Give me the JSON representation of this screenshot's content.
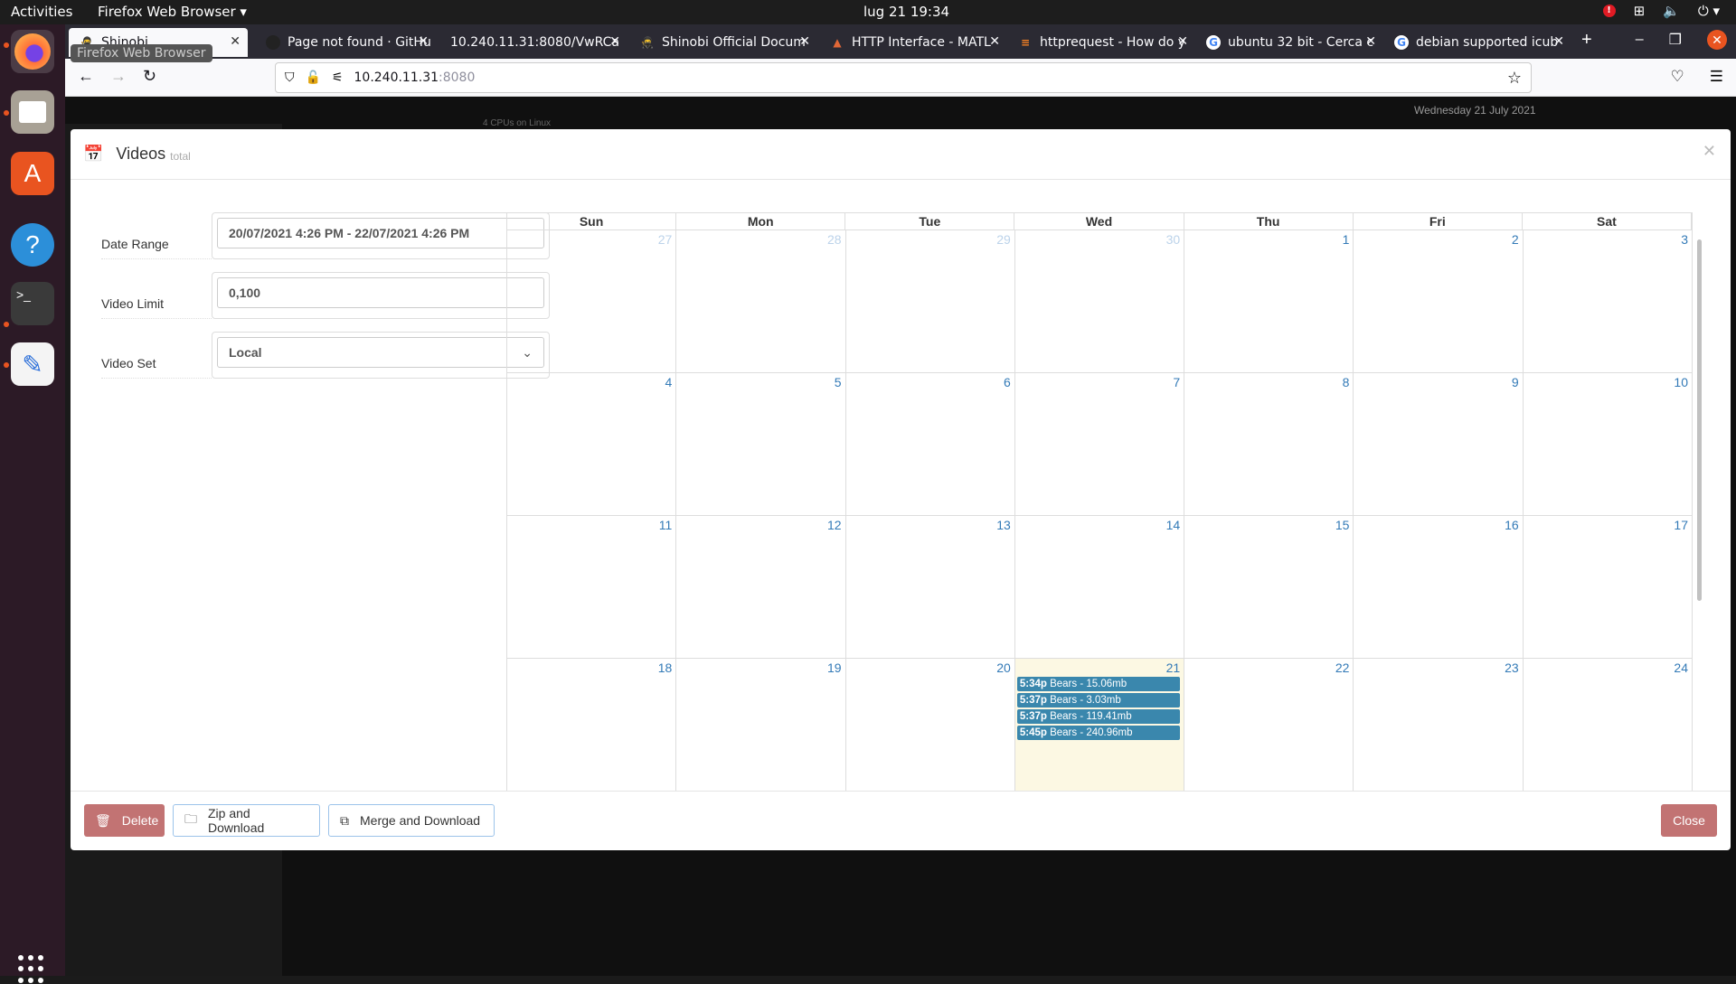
{
  "topbar": {
    "activities": "Activities",
    "app": "Firefox Web Browser ▾",
    "clock": "lug 21  19:34"
  },
  "browser": {
    "tooltip": "Firefox Web Browser",
    "tabs": [
      {
        "title": "Shinobi",
        "active": true
      },
      {
        "title": "Page not found · GitHu"
      },
      {
        "title": "10.240.11.31:8080/VwRCa"
      },
      {
        "title": "Shinobi Official Docum"
      },
      {
        "title": "HTTP Interface - MATL"
      },
      {
        "title": "httprequest - How do y"
      },
      {
        "title": "ubuntu 32 bit - Cerca c"
      },
      {
        "title": "debian supported icub"
      }
    ],
    "url_host": "10.240.11.31",
    "url_port": ":8080"
  },
  "dashboard": {
    "date": "Wednesday 21 July 2021",
    "cpu": "4 CPUs on Linux"
  },
  "modal": {
    "title": "Videos",
    "subtitle": "total",
    "form": {
      "date_range_label": "Date Range",
      "date_range_value": "20/07/2021 4:26 PM - 22/07/2021 4:26 PM",
      "video_limit_label": "Video Limit",
      "video_limit_value": "0,100",
      "video_set_label": "Video Set",
      "video_set_value": "Local"
    },
    "calendar": {
      "days": [
        "Sun",
        "Mon",
        "Tue",
        "Wed",
        "Thu",
        "Fri",
        "Sat"
      ],
      "weeks": [
        [
          "27",
          "28",
          "29",
          "30",
          "1",
          "2",
          "3"
        ],
        [
          "4",
          "5",
          "6",
          "7",
          "8",
          "9",
          "10"
        ],
        [
          "11",
          "12",
          "13",
          "14",
          "15",
          "16",
          "17"
        ],
        [
          "18",
          "19",
          "20",
          "21",
          "22",
          "23",
          "24"
        ]
      ],
      "events": [
        {
          "time": "5:34p",
          "title": "Bears - 15.06mb"
        },
        {
          "time": "5:37p",
          "title": "Bears - 3.03mb"
        },
        {
          "time": "5:37p",
          "title": "Bears - 119.41mb"
        },
        {
          "time": "5:45p",
          "title": "Bears - 240.96mb"
        }
      ]
    },
    "buttons": {
      "delete": "Delete",
      "zip": "Zip and Download",
      "merge": "Merge and Download",
      "close": "Close"
    }
  }
}
